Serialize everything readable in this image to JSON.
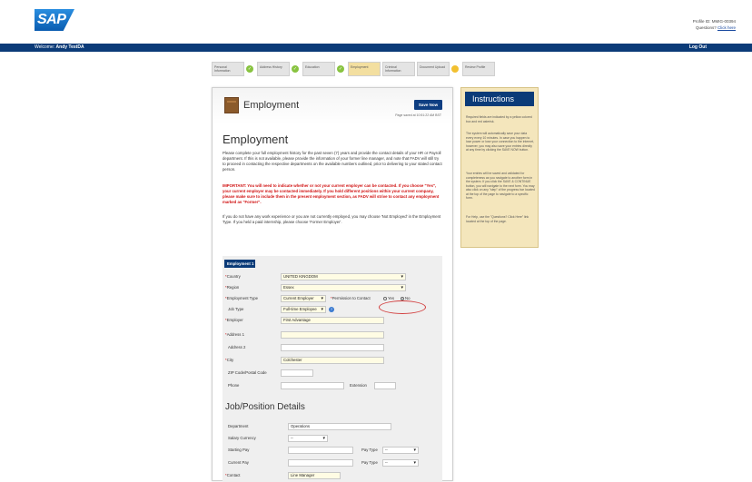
{
  "header": {
    "logo": "SAP",
    "profile_line": "Profile ID: MMIG-00394",
    "question_text": "Questions?",
    "click_here": "Click here"
  },
  "navbar": {
    "welcome_label": "Welcome:",
    "user_name": "Andy TestDA",
    "logout": "Log Out"
  },
  "steps": [
    {
      "label": "Personal Information",
      "status": "done"
    },
    {
      "label": "Address History",
      "status": "done"
    },
    {
      "label": "Education",
      "status": "done"
    },
    {
      "label": "Employment",
      "status": "current"
    },
    {
      "label": "Criminal Information",
      "status": "pending"
    },
    {
      "label": "Document Upload",
      "status": "pending"
    },
    {
      "label": "Review Profile",
      "status": "pending"
    }
  ],
  "page": {
    "title": "Employment",
    "save_button": "Save Now",
    "page_saved": "Page saved at 10:51:22 AM BST",
    "section_title": "Employment",
    "para1": "Please complete your full employment history for the past seven (7) years and provide the contact details of your HR or Payroll department. If this is not available, please provide the information of your former line manager, and note that FADV will still try to proceed in contacting the respective departments on the available numbers outlined, prior to delivering to your stated contact person.",
    "para2": "IMPORTANT: You will need to indicate whether or not your current employer can be contacted. If you choose \"Yes\", your current employer may be contacted immediately. If you hold different positions within your current company, please make sure to include them in the present employment section, as FADV will strive to contact any employment marked as \"Former\".",
    "para3": "If you do not have any work experience or you are not currently employed, you may choose 'Not Employed' in the Employment Type. If you held a paid internship, please choose 'Former Employer'."
  },
  "form": {
    "tab": "Employment 1",
    "country_label": "Country",
    "country_value": "UNITED KINGDOM",
    "region_label": "Region",
    "region_value": "Essex",
    "emp_type_label": "Employment Type",
    "emp_type_value": "Current Employer",
    "permission_label": "Permission to Contact",
    "yes_label": "Yes",
    "no_label": "No",
    "job_type_label": "Job Type",
    "job_type_value": "Full-time Employee",
    "employer_label": "Employer",
    "employer_value": "First Advantage",
    "address1_label": "Address 1",
    "address1_value": "",
    "address2_label": "Address 2",
    "address2_value": "",
    "city_label": "City",
    "city_value": "Colchester",
    "zip_label": "ZIP Code/Postal Code",
    "zip_value": "",
    "phone_label": "Phone",
    "phone_value": "",
    "extension_label": "Extension",
    "extension_value": "",
    "job_section_title": "Job/Position Details",
    "department_label": "Department",
    "department_value": "Operations",
    "salary_currency_label": "Salary Currency",
    "salary_currency_value": "--",
    "starting_pay_label": "Starting Pay",
    "starting_pay_value": "",
    "pay_type_label": "Pay Type",
    "pay_type_value": "--",
    "current_pay_label": "Current Pay",
    "current_pay_value": "",
    "pay_type2_label": "Pay Type",
    "pay_type2_value": "--",
    "contact_label": "Contact",
    "contact_value": "Line Manager"
  },
  "instructions": {
    "title": "Instructions",
    "p1": "Required fields are indicated by a yellow colored box and red asterisk.",
    "p2": "The system will automatically save your data every every 10 minutes. In case you happen to lose power or lose your connection to the internet, however, you may also save your entries directly at any time by clicking the SAVE NOW button.",
    "p3": "Your entries will be saved and validated for completeness as you navigate to another form in the system. If you click the SAVE & CONTINUE button, you will navigate to the next form. You may also click on any \"step\" of the progress bar located at the top of the page to navigate to a specific form.",
    "p4": "For Help, use the \"Questions? Click Here\" link located at the top of the page."
  },
  "colors": {
    "navy": "#0b3b78",
    "required_fill": "#fffce4",
    "instructions_bg": "#f4e6bc",
    "annotation_red": "#d24040"
  }
}
